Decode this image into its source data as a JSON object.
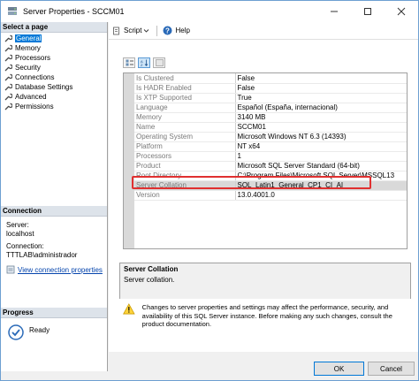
{
  "window": {
    "title": "Server Properties - SCCM01"
  },
  "left": {
    "select_page_label": "Select a page",
    "pages": [
      "General",
      "Memory",
      "Processors",
      "Security",
      "Connections",
      "Database Settings",
      "Advanced",
      "Permissions"
    ],
    "selected_page": "General",
    "connection_label": "Connection",
    "server_label": "Server:",
    "server_value": "localhost",
    "connection_field_label": "Connection:",
    "connection_value": "TTTLAB\\administrador",
    "view_connection_link": "View connection properties",
    "progress_label": "Progress",
    "progress_status": "Ready"
  },
  "toolbar": {
    "script_label": "Script",
    "help_label": "Help"
  },
  "properties": [
    {
      "name": "Is Clustered",
      "value": "False"
    },
    {
      "name": "Is HADR Enabled",
      "value": "False"
    },
    {
      "name": "Is XTP Supported",
      "value": "True"
    },
    {
      "name": "Language",
      "value": "Español (España, internacional)"
    },
    {
      "name": "Memory",
      "value": "3140 MB"
    },
    {
      "name": "Name",
      "value": "SCCM01"
    },
    {
      "name": "Operating System",
      "value": "Microsoft Windows NT 6.3 (14393)"
    },
    {
      "name": "Platform",
      "value": "NT x64"
    },
    {
      "name": "Processors",
      "value": "1"
    },
    {
      "name": "Product",
      "value": "Microsoft SQL Server Standard (64-bit)"
    },
    {
      "name": "Root Directory",
      "value": "C:\\Program Files\\Microsoft SQL Server\\MSSQL13"
    },
    {
      "name": "Server Collation",
      "value": "SQL_Latin1_General_CP1_CI_AI"
    },
    {
      "name": "Version",
      "value": "13.0.4001.0"
    }
  ],
  "highlighted_property": "Server Collation",
  "description": {
    "title": "Server Collation",
    "text": "Server collation."
  },
  "warning": {
    "text": "Changes to server properties and settings may affect the performance, security, and availability of this SQL Server instance. Before making any such changes, consult the product documentation."
  },
  "buttons": {
    "ok": "OK",
    "cancel": "Cancel"
  },
  "colors": {
    "selection": "#0078d7",
    "highlight_box": "#e03030",
    "link": "#0645ad"
  }
}
